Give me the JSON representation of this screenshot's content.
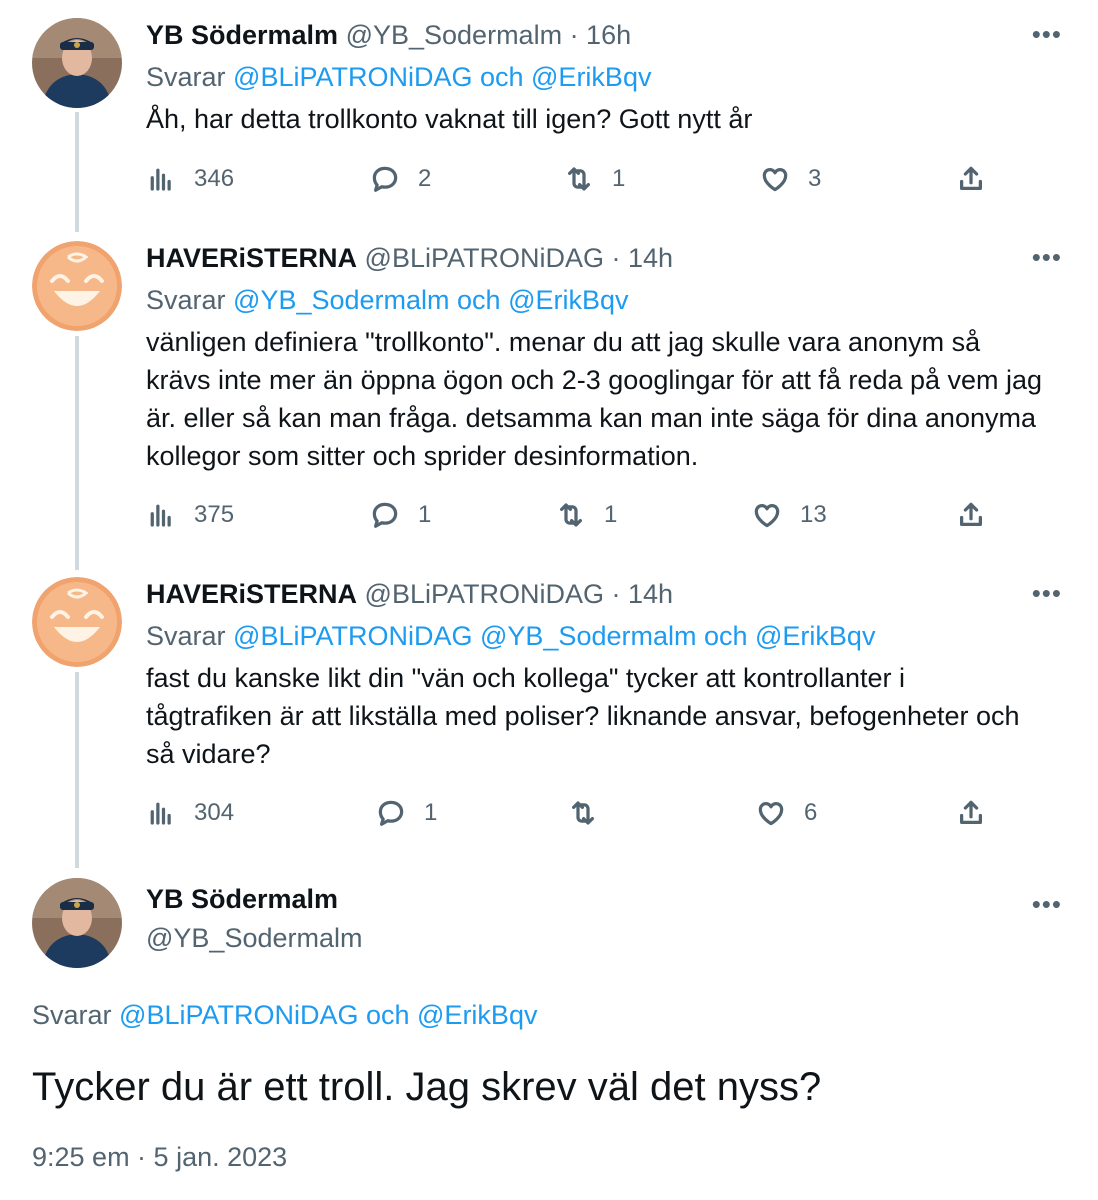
{
  "tweets": [
    {
      "name": "YB Södermalm",
      "handle": "@YB_Sodermalm · 16h",
      "reply_prefix": "Svarar",
      "reply_to": "@BLiPATRONiDAG och @ErikBqv",
      "text": "Åh, har detta trollkonto vaknat till igen? Gott nytt år",
      "views": "346",
      "replies": "2",
      "retweets": "1",
      "likes": "3"
    },
    {
      "name": "HAVERiSTERNA",
      "handle": "@BLiPATRONiDAG · 14h",
      "reply_prefix": "Svarar",
      "reply_to": "@YB_Sodermalm och @ErikBqv",
      "text_lines": [
        "vänligen definiera \"trollkonto\". menar du att jag skulle vara anonym så",
        "krävs inte mer än öppna ögon och 2-3 googlingar för att få reda på vem jag",
        "är. eller så kan man fråga. detsamma kan man inte säga för dina anonyma",
        "kollegor som sitter och sprider desinformation."
      ],
      "views": "375",
      "replies": "1",
      "retweets": "1",
      "likes": "13"
    },
    {
      "name": "HAVERiSTERNA",
      "handle": "@BLiPATRONiDAG · 14h",
      "reply_prefix": "Svarar",
      "reply_to": "@BLiPATRONiDAG @YB_Sodermalm och @ErikBqv",
      "text_lines": [
        "fast du kanske likt din \"vän och kollega\" tycker att kontrollanter i",
        "tågtrafiken är att likställa med poliser? liknande ansvar, befogenheter och",
        "så vidare?"
      ],
      "views": "304",
      "replies": "1",
      "retweets": "",
      "likes": "6"
    }
  ],
  "main_tweet": {
    "name": "YB Södermalm",
    "handle": "@YB_Sodermalm",
    "reply_prefix": "Svarar",
    "reply_to": "@BLiPATRONiDAG och @ErikBqv",
    "text": "Tycker du är ett troll. Jag skrev väl det nyss?",
    "timestamp": "9:25 em · 5 jan. 2023"
  },
  "icons": {
    "more": "more-horizontal-icon",
    "views": "analytics-icon",
    "reply": "reply-icon",
    "retweet": "retweet-icon",
    "like": "heart-icon",
    "share": "share-icon"
  },
  "colors": {
    "link": "#1d9bf0",
    "secondary_text": "#536471",
    "thread_line": "#cfd9de"
  }
}
